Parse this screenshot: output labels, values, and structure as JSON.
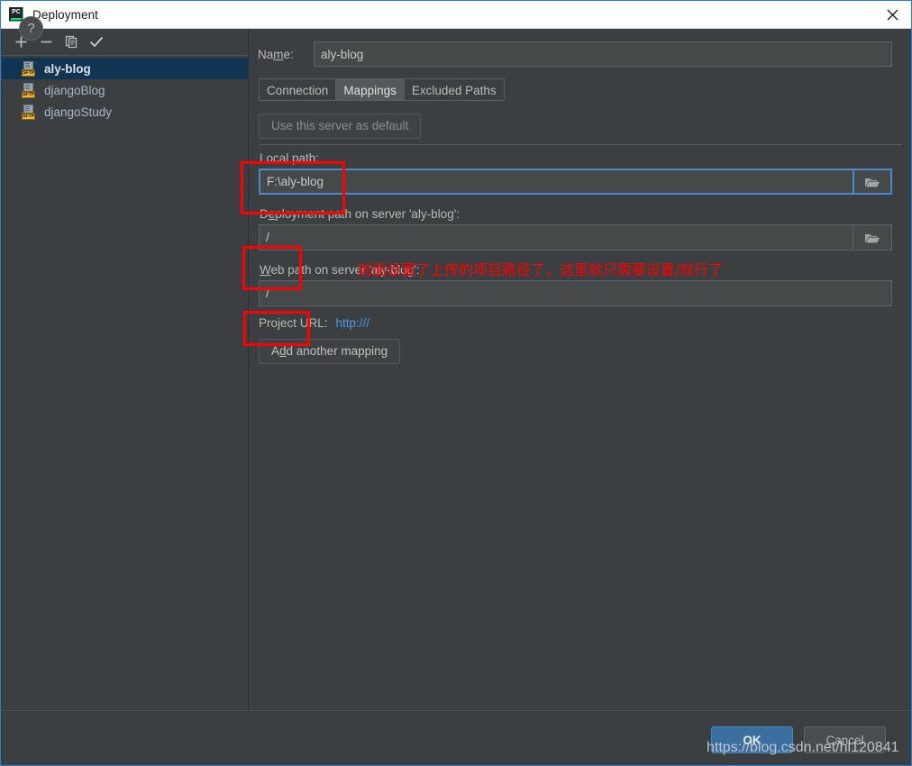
{
  "window": {
    "title": "Deployment",
    "app_icon": "pycharm-logo-icon",
    "close_icon": "close-icon"
  },
  "sidebar": {
    "toolbar": [
      {
        "name": "add-server-button",
        "icon": "plus-icon",
        "label": "+"
      },
      {
        "name": "remove-server-button",
        "icon": "minus-icon",
        "label": "−"
      },
      {
        "name": "copy-server-button",
        "icon": "copy-icon",
        "label": "Copy"
      },
      {
        "name": "set-default-button",
        "icon": "check-icon",
        "label": "✓"
      }
    ],
    "servers": [
      {
        "label": "aly-blog",
        "icon": "sftp-icon",
        "badge": "SFTP",
        "selected": true
      },
      {
        "label": "djangoBlog",
        "icon": "sftp-icon",
        "badge": "SFTP",
        "selected": false
      },
      {
        "label": "djangoStudy",
        "icon": "sftp-icon",
        "badge": "SFTP",
        "selected": false
      }
    ]
  },
  "main": {
    "name_label_pre": "Na",
    "name_label_mnemonic": "m",
    "name_label_post": "e:",
    "name_value": "aly-blog",
    "tabs": [
      {
        "label": "Connection",
        "active": false
      },
      {
        "label": "Mappings",
        "active": true
      },
      {
        "label": "Excluded Paths",
        "active": false
      }
    ],
    "use_default_button": "Use this server as default",
    "local_path": {
      "label_pre": "",
      "label_mnemonic": "L",
      "label_post": "ocal path:",
      "value": "F:\\aly-blog",
      "browse_icon": "folder-icon",
      "focused": true
    },
    "deployment_path": {
      "label_pre": "D",
      "label_mnemonic": "e",
      "label_post": "ployment path on server 'aly-blog':",
      "value": "/",
      "browse_icon": "folder-icon",
      "focused": false
    },
    "web_path": {
      "label_pre": "",
      "label_mnemonic": "W",
      "label_post": "eb path on server 'aly-blog':",
      "value": "/",
      "focused": false
    },
    "project_url_label": "Project URL:",
    "project_url_value": "http:///",
    "add_mapping_pre": "A",
    "add_mapping_mnemonic": "d",
    "add_mapping_post": "d another mapping"
  },
  "footer": {
    "help_label": "?",
    "ok_label": "OK",
    "cancel_label": "Cancel"
  },
  "annotations": {
    "note_text": "前面设置了上传的项目路径了，这里就只需要设置/就行了",
    "highlight_color": "#fe0000",
    "boxes": [
      {
        "name": "local-path-highlight"
      },
      {
        "name": "deployment-path-highlight"
      },
      {
        "name": "web-path-highlight"
      }
    ]
  },
  "watermark": {
    "text": "https://blog.csdn.net/hl120841"
  },
  "colors": {
    "panel_bg": "#3c3f41",
    "field_bg": "#45494a",
    "selected_row": "#113452",
    "accent_blue": "#4a88c7",
    "link_blue": "#4a9ae0",
    "ok_button": "#3c6e9f",
    "annotation_red": "#fe0000"
  }
}
